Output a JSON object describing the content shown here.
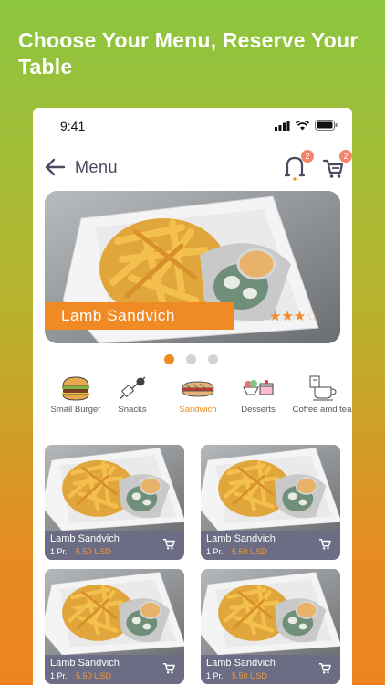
{
  "headline": "Choose Your Menu, Reserve Your Table",
  "status_bar": {
    "time": "9:41"
  },
  "nav": {
    "title": "Menu",
    "notification_count": "2",
    "cart_count": "2"
  },
  "hero": {
    "title": "Lamb Sandvich",
    "rating": 3,
    "max_rating": 5
  },
  "carousel": {
    "pages": 3,
    "active": 0
  },
  "categories": [
    {
      "label": "Small Burger",
      "icon": "burger-icon"
    },
    {
      "label": "Snacks",
      "icon": "snacks-icon"
    },
    {
      "label": "Sandwich",
      "icon": "sandwich-icon",
      "active": true
    },
    {
      "label": "Desserts",
      "icon": "desserts-icon"
    },
    {
      "label": "Coffee amd tea",
      "icon": "coffee-icon"
    }
  ],
  "items": [
    {
      "name": "Lamb Sandvich",
      "qty": "1 Pr.",
      "price": "5.50 USD"
    },
    {
      "name": "Lamb Sandvich",
      "qty": "1 Pr.",
      "price": "5.50 USD"
    },
    {
      "name": "Lamb Sandvich",
      "qty": "1 Pr.",
      "price": "5.50 USD"
    },
    {
      "name": "Lamb Sandvich",
      "qty": "1 Pr.",
      "price": "5.50 USD"
    }
  ],
  "colors": {
    "accent": "#ef8a24",
    "card_bar": "#6c6d84",
    "badge": "#f3846a"
  }
}
